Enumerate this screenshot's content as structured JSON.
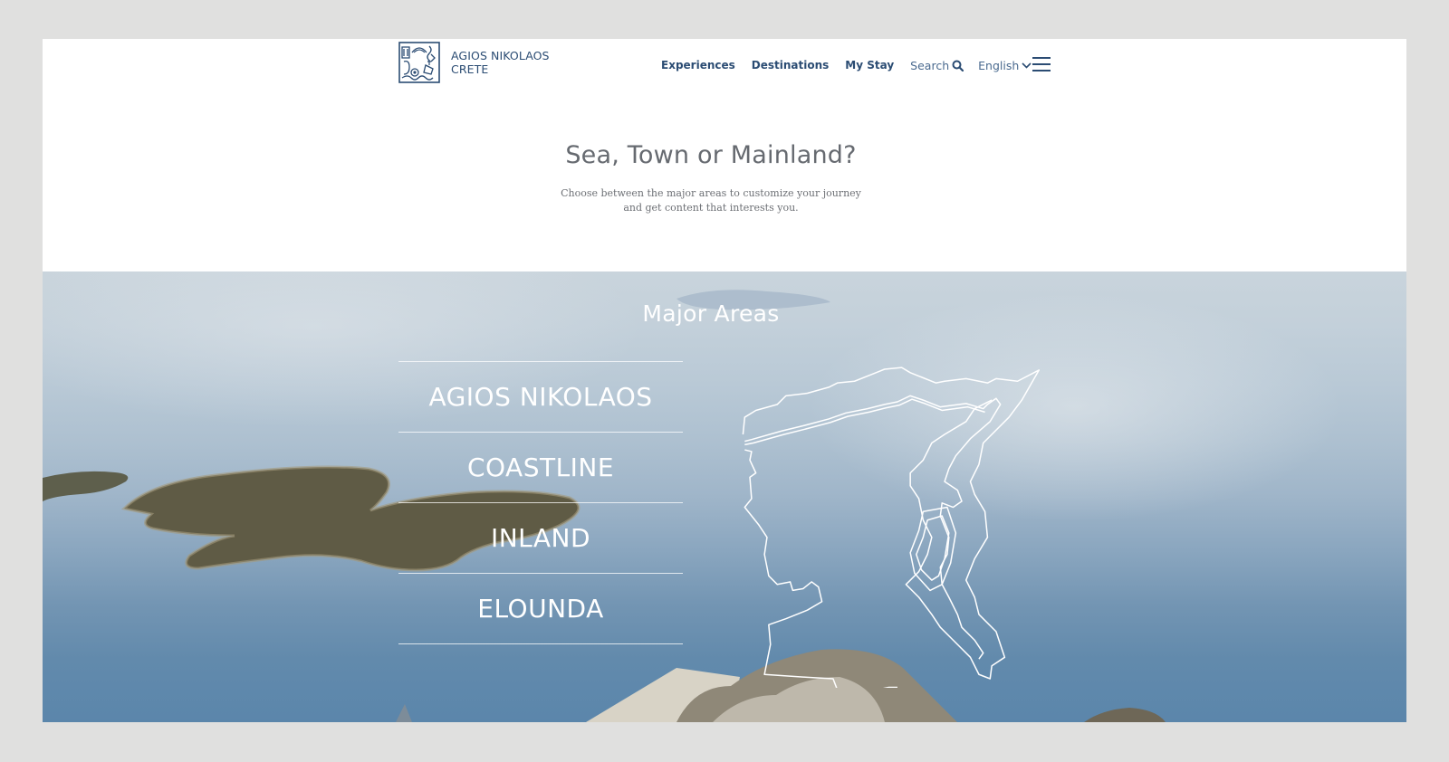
{
  "brand": {
    "name_line1": "AGIOS NIKOLAOS",
    "name_line2": "CRETE",
    "logo_icon": "agios-nikolaos-emblem-icon",
    "color": "#2b4c73"
  },
  "nav": {
    "items": [
      {
        "label": "Experiences"
      },
      {
        "label": "Destinations"
      },
      {
        "label": "My Stay"
      }
    ],
    "search_label": "Search",
    "search_icon": "search-icon",
    "language_label": "English",
    "language_icon": "chevron-down-icon",
    "menu_icon": "hamburger-menu-icon"
  },
  "intro": {
    "title": "Sea, Town or Mainland?",
    "description": "Choose between the major areas to customize your journey and get content that interests you."
  },
  "hero": {
    "section_title": "Major Areas",
    "areas": [
      {
        "label": "AGIOS NIKOLAOS"
      },
      {
        "label": "COASTLINE"
      },
      {
        "label": "INLAND"
      },
      {
        "label": "ELOUNDA"
      }
    ],
    "map_icon": "region-map-outline-icon"
  }
}
